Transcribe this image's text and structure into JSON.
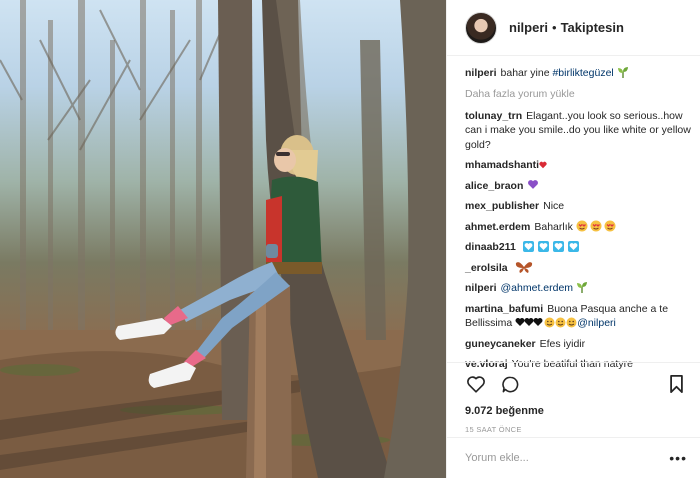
{
  "post": {
    "username": "nilperi",
    "separator": "•",
    "follow_status": "Takiptesin"
  },
  "caption": {
    "username": "nilperi",
    "text": "bahar yine ",
    "hashtag": "#birliktegüzel"
  },
  "load_more": "Daha fazla yorum yükle",
  "comments": [
    {
      "username": "tolunay_trn",
      "text": "Elagant..you look so serious..how can i make you smile..do you like white or yellow gold?"
    },
    {
      "username": "mhamadshanti",
      "text": ""
    },
    {
      "username": "alice_braon",
      "text": ""
    },
    {
      "username": "mex_publisher",
      "text": "Nice"
    },
    {
      "username": "ahmet.erdem",
      "text": "Baharlık"
    },
    {
      "username": "dinaab211",
      "text": ""
    },
    {
      "username": "_erolsila",
      "text": ""
    },
    {
      "username": "nilperi",
      "text": "@ahmet.erdem"
    },
    {
      "username": "martina_bafumi",
      "text": "Buona Pasqua anche a te Bellissima",
      "mention": "@nilperi"
    },
    {
      "username": "guneycaneker",
      "text": "Efes iyidir"
    },
    {
      "username": "ve.vloraj",
      "text": "You're beatiful than natyre"
    }
  ],
  "likes": "9.072 beğenme",
  "timestamp": "15 SAAT ÖNCE",
  "add_comment_placeholder": "Yorum ekle...",
  "more_options": "•••",
  "icons": {
    "like": "heart-outline-icon",
    "comment": "comment-bubble-icon",
    "save": "bookmark-icon",
    "sprout": "seedling-emoji",
    "blue_heart": "#3bb8e8",
    "purple_heart": "#8a4fc7",
    "red_heart": "#d92a35"
  }
}
